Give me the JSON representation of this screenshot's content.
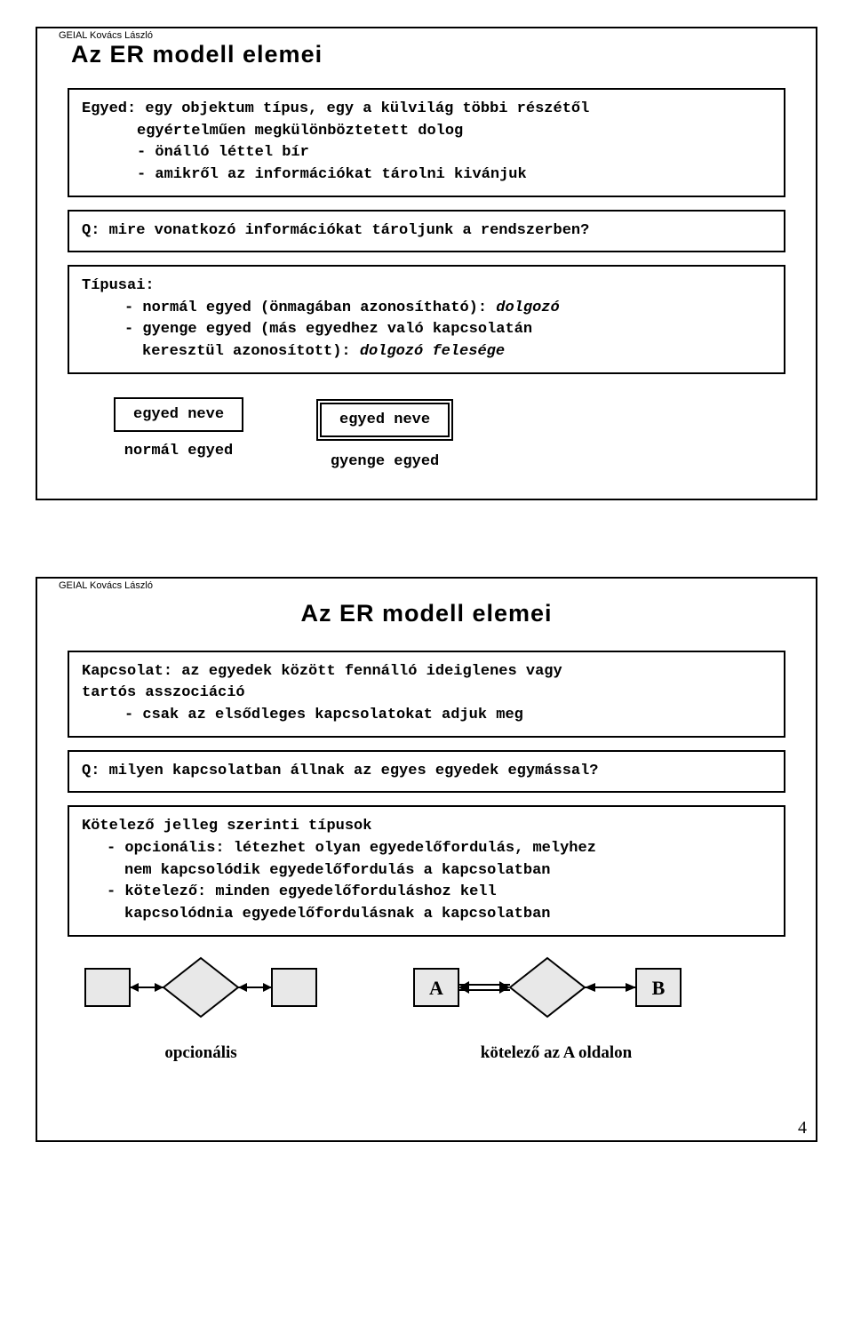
{
  "pageNumber": "4",
  "slide1": {
    "title": "Az ER modell elemei",
    "box1": {
      "l1": "Egyed: egy objektum típus, egy a külvilág többi részétől",
      "l2": "egyértelműen megkülönböztetett dolog",
      "l3": "- önálló léttel bír",
      "l4": "- amikről az információkat tárolni kivánjuk"
    },
    "box2": "Q: mire vonatkozó információkat tároljunk  a rendszerben?",
    "box3": {
      "l1": "Típusai:",
      "l2": "- normál egyed (önmagában azonosítható): ",
      "l2i": "dolgozó",
      "l3": "- gyenge egyed (más egyedhez való kapcsolatán",
      "l4": "keresztül azonosított): ",
      "l4i": "dolgozó felesége"
    },
    "fig": {
      "box1": "egyed neve",
      "cap1": "normál egyed",
      "box2": "egyed neve",
      "cap2": "gyenge egyed"
    },
    "credit": "GEIAL Kovács László"
  },
  "slide2": {
    "title": "Az ER modell elemei",
    "box1": {
      "l1": "Kapcsolat: az egyedek között fennálló ideiglenes vagy",
      "l2": "tartós asszociáció",
      "l3": "- csak az elsődleges kapcsolatokat adjuk meg"
    },
    "box2": "Q: milyen kapcsolatban állnak az egyes egyedek egymással?",
    "box3": {
      "l1": "Kötelező jelleg szerinti típusok",
      "l2": "- opcionális: létezhet olyan egyedelőfordulás, melyhez",
      "l3": "nem kapcsolódik egyedelőfordulás a kapcsolatban",
      "l4": "- kötelező: minden egyedelőforduláshoz kell",
      "l5": "kapcsolódnia egyedelőfordulásnak a kapcsolatban"
    },
    "fig": {
      "cap1": "opcionális",
      "cap2": "kötelező az A oldalon",
      "labA": "A",
      "labB": "B"
    },
    "credit": "GEIAL Kovács László"
  }
}
